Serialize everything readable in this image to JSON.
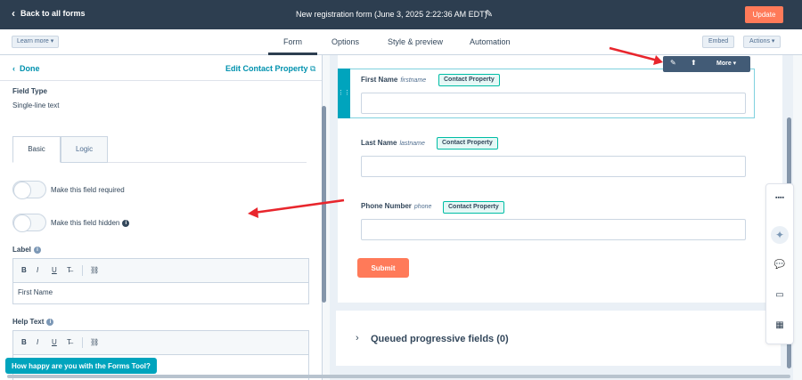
{
  "topbar": {
    "back_label": "Back to all forms",
    "form_title": "New registration form (June 3, 2025 2:22:36 AM EDT)",
    "update_label": "Update"
  },
  "subbar": {
    "learn_more_label": "Learn more",
    "tabs": [
      {
        "label": "Form"
      },
      {
        "label": "Options"
      },
      {
        "label": "Style & preview"
      },
      {
        "label": "Automation"
      }
    ],
    "active_tab": "Form",
    "embed_label": "Embed",
    "actions_label": "Actions"
  },
  "left_panel": {
    "done_label": "Done",
    "edit_property_label": "Edit Contact Property",
    "field_type_label": "Field Type",
    "field_type_value": "Single-line text",
    "subtabs": [
      {
        "label": "Basic"
      },
      {
        "label": "Logic"
      }
    ],
    "toggle_required_label": "Make this field required",
    "toggle_hidden_label": "Make this field hidden",
    "label_section": "Label",
    "label_value": "First Name",
    "help_text_section": "Help Text",
    "feedback_label": "How happy are you with the Forms Tool?"
  },
  "canvas": {
    "fields": [
      {
        "label": "First Name",
        "internal": "firstname",
        "badge": "Contact Property"
      },
      {
        "label": "Last Name",
        "internal": "lastname",
        "badge": "Contact Property"
      },
      {
        "label": "Phone Number",
        "internal": "phone",
        "badge": "Contact Property"
      }
    ],
    "submit_label": "Submit",
    "field_toolbar_more": "More",
    "queued_label": "Queued progressive fields (0)"
  },
  "colors": {
    "topbar": "#2d3e50",
    "accent_orange": "#ff7a59",
    "link_teal": "#0091ae",
    "annotation_arrow": "#e8262d"
  }
}
